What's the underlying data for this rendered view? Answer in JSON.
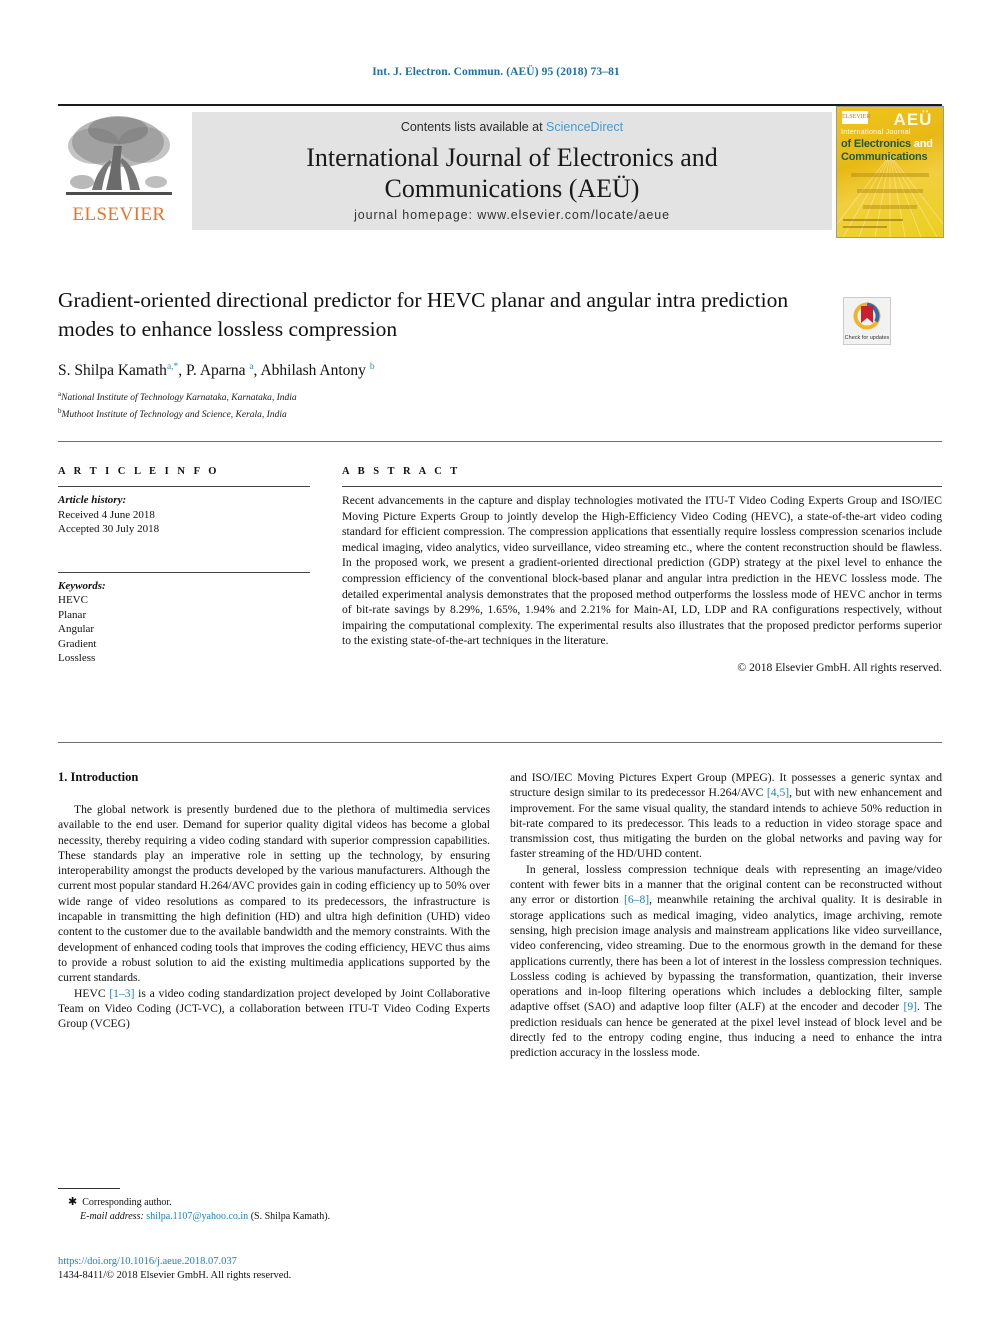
{
  "running_head": "Int. J. Electron. Commun. (AEÜ) 95 (2018) 73–81",
  "masthead": {
    "contents_prefix": "Contents lists available at ",
    "sciencedirect": "ScienceDirect",
    "journal_title_line1": "International Journal of Electronics and",
    "journal_title_line2": "Communications (AEÜ)",
    "homepage": "journal homepage: www.elsevier.com/locate/aeue",
    "publisher_wordmark": "ELSEVIER",
    "cover": {
      "aeu": "AEÜ",
      "line1": "International Journal",
      "line2_green": "of Electronics",
      "line2_white": " and",
      "line3": "Communications",
      "elsevier_tag": "ELSEVIER"
    }
  },
  "article": {
    "title": "Gradient-oriented directional predictor for HEVC planar and angular intra prediction modes to enhance lossless compression",
    "authors_html": "S. Shilpa Kamath<sup>a,*</sup>, P. Aparna <sup>a</sup>, Abhilash Antony <sup>b</sup>",
    "affiliation_a": "National Institute of Technology Karnataka, Karnataka, India",
    "affiliation_b": "Muthoot Institute of Technology and Science, Kerala, India",
    "crossmark_label": "Check for updates"
  },
  "info": {
    "heading": "A R T I C L E   I N F O",
    "history_label": "Article history:",
    "received": "Received 4 June 2018",
    "accepted": "Accepted 30 July 2018",
    "keywords_label": "Keywords:",
    "keywords": [
      "HEVC",
      "Planar",
      "Angular",
      "Gradient",
      "Lossless"
    ]
  },
  "abstract": {
    "heading": "A B S T R A C T",
    "text": "Recent advancements in the capture and display technologies motivated the ITU-T Video Coding Experts Group and ISO/IEC Moving Picture Experts Group to jointly develop the High-Efficiency Video Coding (HEVC), a state-of-the-art video coding standard for efficient compression. The compression applications that essentially require lossless compression scenarios include medical imaging, video analytics, video surveillance, video streaming etc., where the content reconstruction should be flawless. In the proposed work, we present a gradient-oriented directional prediction (GDP) strategy at the pixel level to enhance the compression efficiency of the conventional block-based planar and angular intra prediction in the HEVC lossless mode. The detailed experimental analysis demonstrates that the proposed method outperforms the lossless mode of HEVC anchor in terms of bit-rate savings by 8.29%, 1.65%, 1.94% and 2.21% for Main-AI, LD, LDP and RA configurations respectively, without impairing the computational complexity. The experimental results also illustrates that the proposed predictor performs superior to the existing state-of-the-art techniques in the literature.",
    "copyright": "© 2018 Elsevier GmbH. All rights reserved."
  },
  "body": {
    "section_heading": "1. Introduction",
    "left_p1": "The global network is presently burdened due to the plethora of multimedia services available to the end user. Demand for superior quality digital videos has become a global necessity, thereby requiring a video coding standard with superior compression capabilities. These standards play an imperative role in setting up the technology, by ensuring interoperability amongst the products developed by the various manufacturers. Although the current most popular standard H.264/AVC provides gain in coding efficiency up to 50% over wide range of video resolutions as compared to its predecessors, the infrastructure is incapable in transmitting the high definition (HD) and ultra high definition (UHD) video content to the customer due to the available bandwidth and the memory constraints. With the development of enhanced coding tools that improves the coding efficiency, HEVC thus aims to provide a robust solution to aid the existing multimedia applications supported by the current standards.",
    "left_p2_a": "HEVC ",
    "left_p2_ref": "[1–3]",
    "left_p2_b": " is a video coding standardization project developed by Joint Collaborative Team on Video Coding (JCT-VC), a collaboration between ITU-T Video Coding Experts Group (VCEG)",
    "right_p1_a": "and ISO/IEC Moving Pictures Expert Group (MPEG). It possesses a generic syntax and structure design similar to its predecessor H.264/AVC ",
    "right_p1_ref": "[4,5]",
    "right_p1_b": ", but with new enhancement and improvement. For the same visual quality, the standard intends to achieve 50% reduction in bit-rate compared to its predecessor. This leads to a reduction in video storage space and transmission cost, thus mitigating the burden on the global networks and paving way for faster streaming of the HD/UHD content.",
    "right_p2_a": "In general, lossless compression technique deals with representing an image/video content with fewer bits in a manner that the original content can be reconstructed without any error or distortion ",
    "right_p2_ref1": "[6–8]",
    "right_p2_b": ", meanwhile retaining the archival quality. It is desirable in storage applications such as medical imaging, video analytics, image archiving, remote sensing, high precision image analysis and mainstream applications like video surveillance, video conferencing, video streaming. Due to the enormous growth in the demand for these applications currently, there has been a lot of interest in the lossless compression techniques. Lossless coding is achieved by bypassing the transformation, quantization, their inverse operations and in-loop filtering operations which includes a deblocking filter, sample adaptive offset (SAO) and adaptive loop filter (ALF) at the encoder and decoder ",
    "right_p2_ref2": "[9]",
    "right_p2_c": ". The prediction residuals can hence be generated at the pixel level instead of block level and be directly fed to the entropy coding engine, thus inducing a need to enhance the intra prediction accuracy in the lossless mode."
  },
  "footnote": {
    "corresponding": "Corresponding author.",
    "email_label": "E-mail address:",
    "email": "shilpa.1107@yahoo.co.in",
    "email_owner": "(S. Shilpa Kamath).",
    "doi": "https://doi.org/10.1016/j.aeue.2018.07.037",
    "issn_line": "1434-8411/© 2018 Elsevier GmbH. All rights reserved."
  }
}
